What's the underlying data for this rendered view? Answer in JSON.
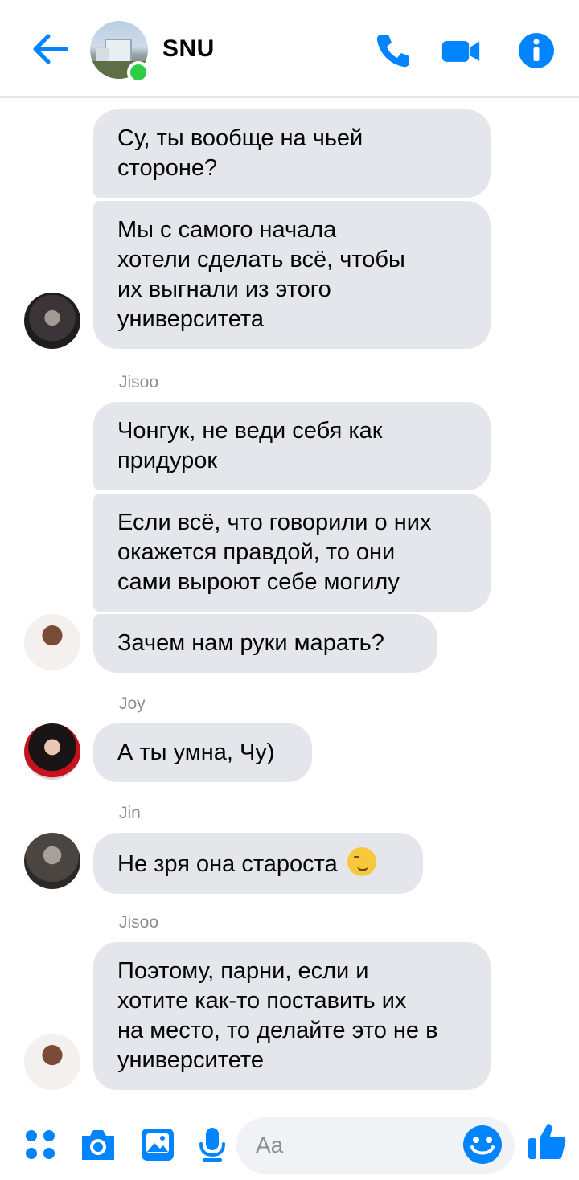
{
  "header": {
    "title": "SNU",
    "back_icon": "arrow-left-icon",
    "call_icon": "phone-icon",
    "video_icon": "video-camera-icon",
    "info_icon": "info-icon",
    "accent_color": "#0084ff",
    "online_color": "#31cc46"
  },
  "messages": [
    {
      "text": "Су, ты вообще на чьей\nстороне?"
    },
    {
      "text": "Мы с самого начала\nхотели сделать всё, чтобы\nих выгнали из этого\nуниверситета"
    },
    {
      "sender": "Jisoo",
      "text": "Чонгук, не веди себя как\nпридурок"
    },
    {
      "text": "Если всё, что говорили о них\nокажется правдой, то они\nсами выроют себе могилу"
    },
    {
      "text": "Зачем нам руки марать?"
    },
    {
      "sender": "Joy",
      "text": "А ты умна, Чу)"
    },
    {
      "sender": "Jin",
      "text": "Не зря она староста",
      "emoji": "smirking-face-emoji"
    },
    {
      "sender": "Jisoo",
      "text": "Поэтому, парни, если и\nхотите как-то поставить их\nна место, то делайте это не в\nуниверситете"
    }
  ],
  "composer": {
    "placeholder": "Aa",
    "icons": [
      "menu-dots-icon",
      "camera-icon",
      "gallery-icon",
      "microphone-icon",
      "emoji-icon",
      "like-icon"
    ]
  }
}
